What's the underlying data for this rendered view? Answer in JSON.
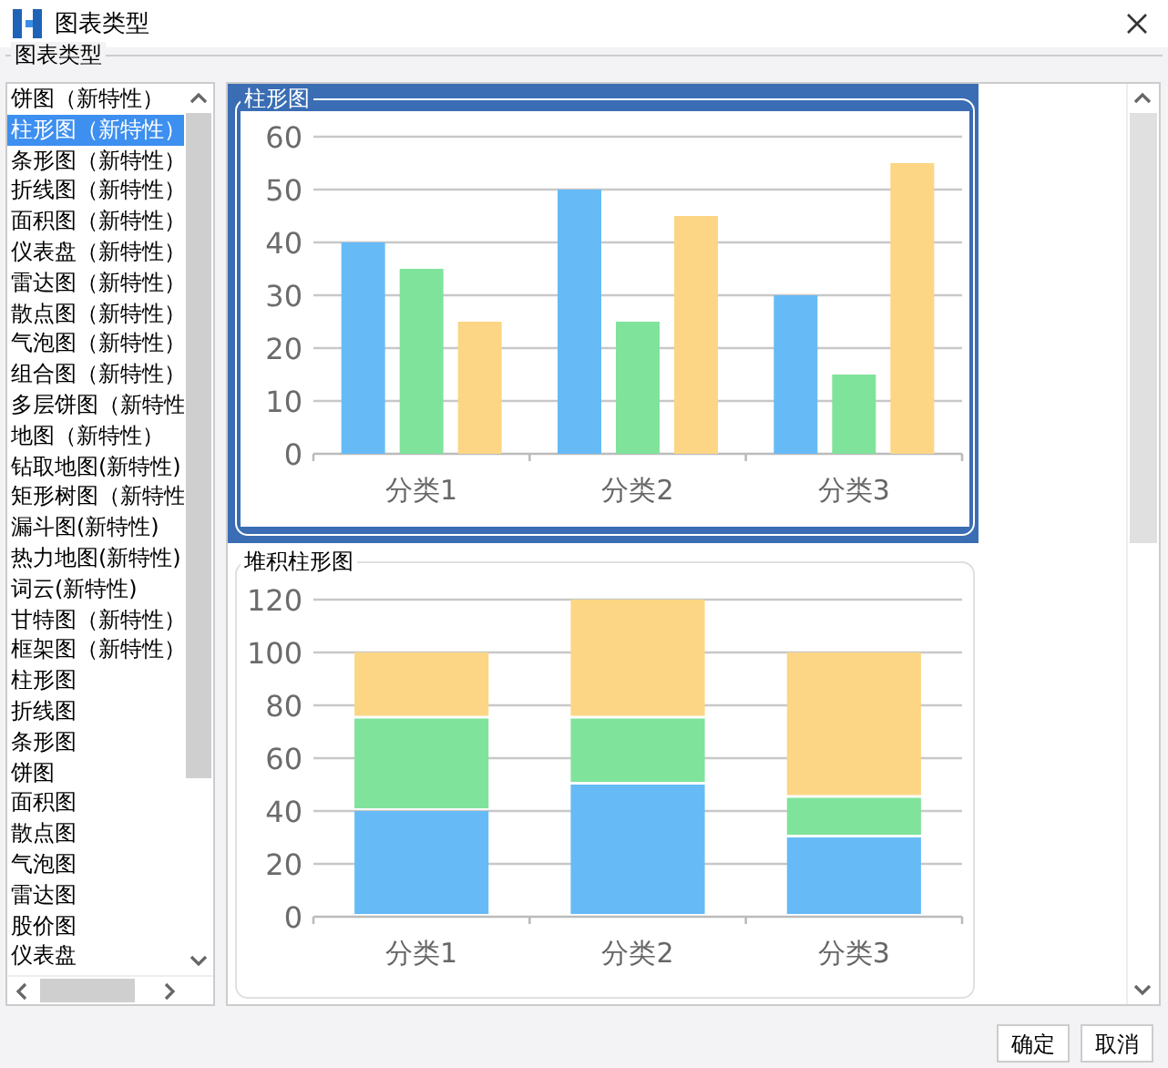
{
  "window": {
    "title": "图表类型"
  },
  "group_label": "图表类型",
  "chart_types": [
    {
      "label": "饼图（新特性）",
      "selected": false
    },
    {
      "label": "柱形图（新特性）",
      "selected": true
    },
    {
      "label": "条形图（新特性）",
      "selected": false
    },
    {
      "label": "折线图（新特性）",
      "selected": false
    },
    {
      "label": "面积图（新特性）",
      "selected": false
    },
    {
      "label": "仪表盘（新特性）",
      "selected": false
    },
    {
      "label": "雷达图（新特性）",
      "selected": false
    },
    {
      "label": "散点图（新特性）",
      "selected": false
    },
    {
      "label": "气泡图（新特性）",
      "selected": false
    },
    {
      "label": "组合图（新特性）",
      "selected": false
    },
    {
      "label": "多层饼图（新特性",
      "selected": false
    },
    {
      "label": "地图（新特性）",
      "selected": false
    },
    {
      "label": "钻取地图(新特性)",
      "selected": false
    },
    {
      "label": "矩形树图（新特性",
      "selected": false
    },
    {
      "label": "漏斗图(新特性)",
      "selected": false
    },
    {
      "label": "热力地图(新特性)",
      "selected": false
    },
    {
      "label": "词云(新特性)",
      "selected": false
    },
    {
      "label": "甘特图（新特性）",
      "selected": false
    },
    {
      "label": "框架图（新特性）",
      "selected": false
    },
    {
      "label": "柱形图",
      "selected": false
    },
    {
      "label": "折线图",
      "selected": false
    },
    {
      "label": "条形图",
      "selected": false
    },
    {
      "label": "饼图",
      "selected": false
    },
    {
      "label": "面积图",
      "selected": false
    },
    {
      "label": "散点图",
      "selected": false
    },
    {
      "label": "气泡图",
      "selected": false
    },
    {
      "label": "雷达图",
      "selected": false
    },
    {
      "label": "股价图",
      "selected": false
    },
    {
      "label": "仪表盘",
      "selected": false
    }
  ],
  "previews": [
    {
      "title": "柱形图",
      "selected": true,
      "chart_data": {
        "type": "bar",
        "categories": [
          "分类1",
          "分类2",
          "分类3"
        ],
        "ylim": [
          0,
          60
        ],
        "grid": true,
        "yticks": [
          0,
          10,
          20,
          30,
          40,
          50,
          60
        ],
        "stacked": false,
        "series": [
          {
            "color": "#66bbf7",
            "values": [
              40,
              50,
              30
            ]
          },
          {
            "color": "#80e39c",
            "values": [
              35,
              25,
              15
            ]
          },
          {
            "color": "#fcd684",
            "values": [
              25,
              45,
              55
            ]
          }
        ]
      }
    },
    {
      "title": "堆积柱形图",
      "selected": false,
      "chart_data": {
        "type": "bar",
        "categories": [
          "分类1",
          "分类2",
          "分类3"
        ],
        "ylim": [
          0,
          120
        ],
        "grid": true,
        "yticks": [
          0,
          20,
          40,
          60,
          80,
          100,
          120
        ],
        "stacked": true,
        "series": [
          {
            "color": "#66bbf7",
            "values": [
              40,
              50,
              30
            ]
          },
          {
            "color": "#80e39c",
            "values": [
              35,
              25,
              15
            ]
          },
          {
            "color": "#fcd684",
            "values": [
              25,
              45,
              55
            ]
          }
        ]
      }
    }
  ],
  "buttons": [
    "确定",
    "取消"
  ]
}
